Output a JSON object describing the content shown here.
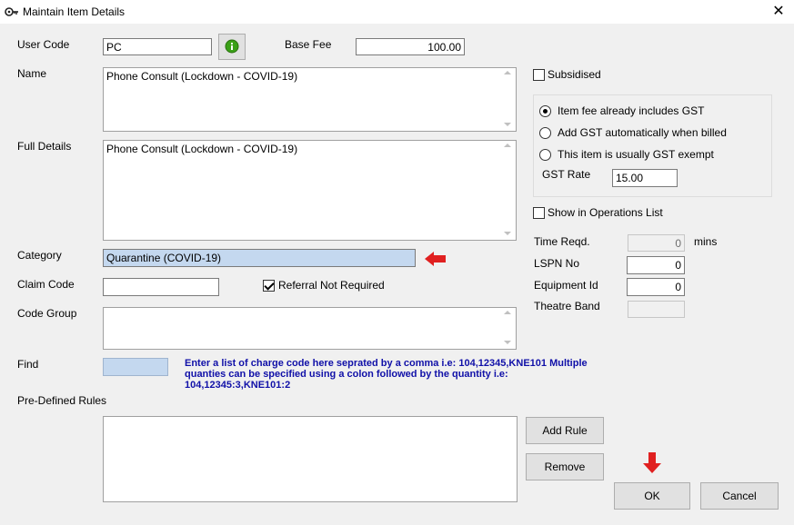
{
  "window": {
    "title": "Maintain Item Details",
    "close_glyph": "✕",
    "icon": "gear-key-icon"
  },
  "fields": {
    "user_code_label": "User Code",
    "user_code_value": "PC",
    "base_fee_label": "Base Fee",
    "base_fee_value": "100.00",
    "name_label": "Name",
    "name_value": "Phone Consult (Lockdown - COVID-19)",
    "full_details_label": "Full Details",
    "full_details_value": "Phone Consult (Lockdown - COVID-19)",
    "category_label": "Category",
    "category_value": "Quarantine (COVID-19)",
    "claim_code_label": "Claim Code",
    "claim_code_value": "",
    "referral_label": "Referral Not Required",
    "referral_checked": true,
    "code_group_label": "Code Group",
    "code_group_value": "",
    "find_label": "Find",
    "find_value": "",
    "hint_text": "Enter a list of charge code here seprated by a comma i.e: 104,12345,KNE101 Multiple quanties can be specified using a colon followed by the quantity i.e: 104,12345:3,KNE101:2",
    "predefined_rules_label": "Pre-Defined Rules"
  },
  "right_panel": {
    "subsidised_label": "Subsidised",
    "subsidised_checked": false,
    "gst_options": [
      {
        "label": "Item fee already includes GST",
        "checked": true
      },
      {
        "label": "Add GST automatically when billed",
        "checked": false
      },
      {
        "label": "This item is usually GST exempt",
        "checked": false
      }
    ],
    "gst_rate_label": "GST Rate",
    "gst_rate_value": "15.00",
    "show_ops_label": "Show in Operations List",
    "show_ops_checked": false,
    "time_reqd_label": "Time Reqd.",
    "time_reqd_value": "0",
    "time_reqd_unit": "mins",
    "lspn_label": "LSPN No",
    "lspn_value": "0",
    "equipment_label": "Equipment Id",
    "equipment_value": "0",
    "theatre_band_label": "Theatre Band",
    "theatre_band_value": ""
  },
  "buttons": {
    "add_rule": "Add Rule",
    "remove": "Remove",
    "ok": "OK",
    "cancel": "Cancel"
  },
  "colors": {
    "annotation_arrow": "#e02020",
    "info_button": "#3aa017",
    "hint_text": "#1010a8",
    "category_fill": "#c4d8ef"
  }
}
